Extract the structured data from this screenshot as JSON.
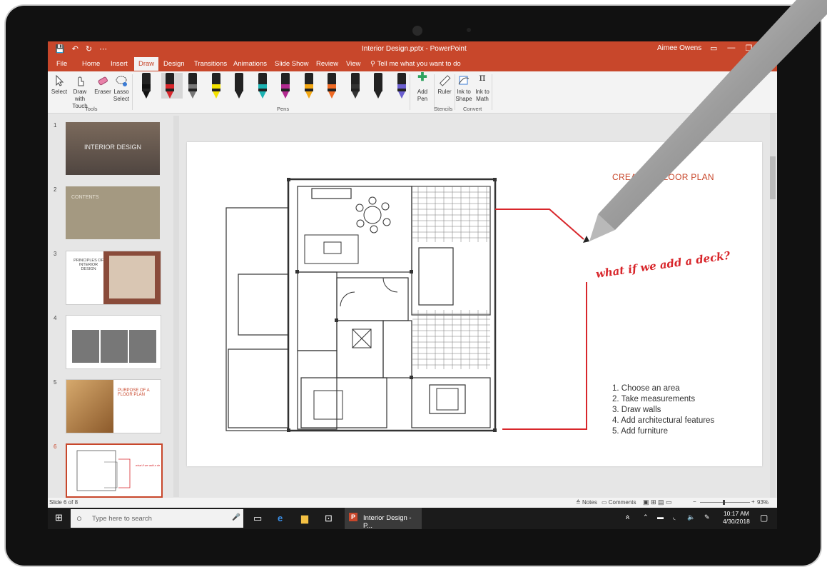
{
  "app": {
    "title": "Interior Design.pptx - PowerPoint",
    "user": "Aimee Owens",
    "quick_access": [
      "💾",
      "↶",
      "↻",
      "⋯"
    ],
    "window_controls": [
      "▭",
      "—",
      "❐"
    ]
  },
  "tabs": [
    "File",
    "Home",
    "Insert",
    "Draw",
    "Design",
    "Transitions",
    "Animations",
    "Slide Show",
    "Review",
    "View"
  ],
  "active_tab": "Draw",
  "tell_me": "Tell me what you want to do",
  "ribbon": {
    "tools": {
      "select": "Select",
      "draw_with_touch": "Draw with Touch",
      "eraser": "Eraser",
      "lasso": "Lasso Select",
      "group": "Tools"
    },
    "pens_group": "Pens",
    "pens": [
      {
        "band": "#111111",
        "selected": false
      },
      {
        "band": "#d8262b",
        "selected": true
      },
      {
        "band": "#777777",
        "selected": false
      },
      {
        "band": "#f4e200",
        "selected": false
      },
      {
        "band": "#222222",
        "selected": false
      },
      {
        "band": "#1cb3b3",
        "selected": false
      },
      {
        "band": "#b2298f",
        "selected": false
      },
      {
        "band": "#f3a712",
        "selected": false
      },
      {
        "band": "#ef6a24",
        "selected": false
      },
      {
        "band": "#333333",
        "selected": false
      },
      {
        "band": "#222222",
        "selected": false
      },
      {
        "band": "#6b5fd0",
        "selected": false
      }
    ],
    "add_pen": "Add Pen",
    "ruler": "Ruler",
    "stencils_group": "Stencils",
    "ink_to_shape": "Ink to Shape",
    "ink_to_math": "Ink to Math",
    "convert_group": "Convert"
  },
  "thumbnails": [
    {
      "num": "1",
      "label": "INTERIOR DESIGN"
    },
    {
      "num": "2",
      "label": "CONTENTS"
    },
    {
      "num": "3",
      "label": "PRINCIPLES OF INTERIOR DESIGN"
    },
    {
      "num": "4",
      "label": ""
    },
    {
      "num": "5",
      "label": "PURPOSE OF A FLOOR PLAN"
    },
    {
      "num": "6",
      "label": ""
    }
  ],
  "slide": {
    "title": "CREATE A FLOOR PLAN",
    "steps": [
      "1. Choose an area",
      "2. Take measurements",
      "3. Draw walls",
      "4. Add architectural features",
      "5. Add furniture"
    ],
    "ink_note": "what if we add a deck?"
  },
  "status": {
    "slide_info": "Slide 6 of 8",
    "notes": "Notes",
    "comments": "Comments",
    "zoom": "93%"
  },
  "taskbar": {
    "search_placeholder": "Type here to search",
    "app_label": "Interior Design - P...",
    "time": "10:17 AM",
    "date": "4/30/2018"
  },
  "colors": {
    "accent": "#c8472b",
    "ink": "#d8262b"
  }
}
